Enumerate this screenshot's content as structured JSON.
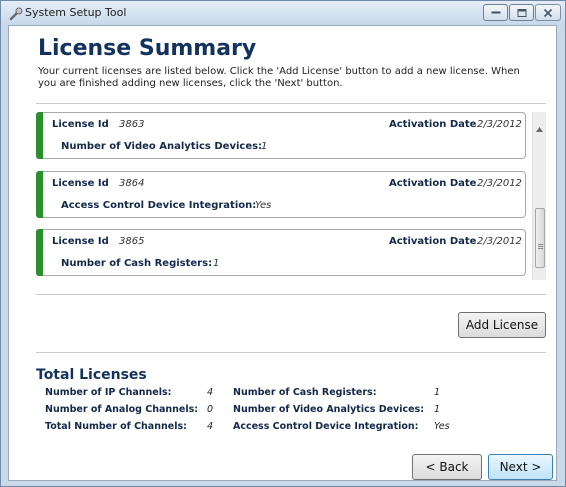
{
  "window": {
    "title": "System Setup Tool"
  },
  "page": {
    "title": "License Summary",
    "intro": "Your current licenses are listed below. Click the 'Add License' button to add a new license. When you are finished adding new licenses, click the 'Next' button."
  },
  "licenses": [
    {
      "id_label": "License Id",
      "id": "3863",
      "date_label": "Activation Date",
      "date": "2/3/2012",
      "feature_label": "Number of Video Analytics Devices:",
      "feature_value": "1"
    },
    {
      "id_label": "License Id",
      "id": "3864",
      "date_label": "Activation Date",
      "date": "2/3/2012",
      "feature_label": "Access Control Device Integration:",
      "feature_value": "Yes"
    },
    {
      "id_label": "License Id",
      "id": "3865",
      "date_label": "Activation Date",
      "date": "2/3/2012",
      "feature_label": "Number of Cash Registers:",
      "feature_value": "1"
    }
  ],
  "buttons": {
    "add_license": "Add License",
    "back": "< Back",
    "next": "Next >"
  },
  "totals": {
    "title": "Total Licenses",
    "left": [
      {
        "label": "Number of IP Channels:",
        "value": "4"
      },
      {
        "label": "Number of Analog Channels:",
        "value": "0"
      },
      {
        "label": "Total Number of Channels:",
        "value": "4"
      }
    ],
    "right": [
      {
        "label": "Number of Cash Registers:",
        "value": "1"
      },
      {
        "label": "Number of Video Analytics Devices:",
        "value": "1"
      },
      {
        "label": "Access Control Device Integration:",
        "value": "Yes"
      }
    ]
  },
  "colors": {
    "accent_green": "#2b8f2d",
    "title_blue": "#13325e"
  },
  "icons": {
    "app": "tool-icon",
    "minimize": "minimize-icon",
    "maximize": "maximize-icon",
    "close": "close-icon"
  }
}
